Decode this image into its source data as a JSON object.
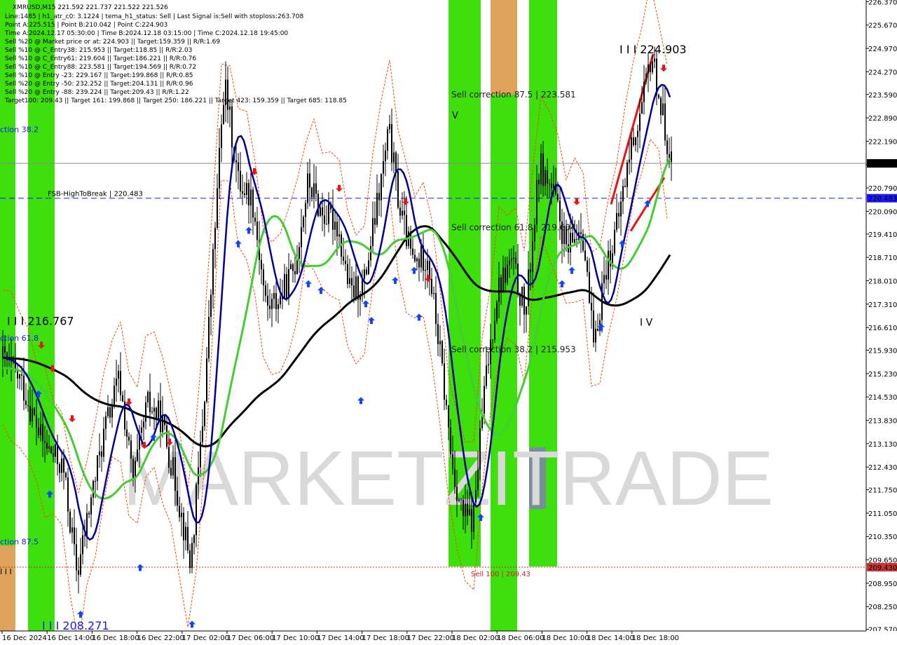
{
  "chart_data": {
    "type": "candlestick",
    "symbol_line": "XMRUSD,M15  221.592 221.737 221.522 221.526",
    "info_lines": [
      "Line:1485  | h1_atr_c0: 3.1224  | tema_h1_status: Sell  | Last Signal is:Sell with stoploss:263.708",
      "Point A:225.515  | Point B:210.042  | Point C:224.903",
      "Time A:2024.12.17 05:30:00  | Time B:2024.12.18 03:15:00  | Time C:2024.12.18 19:45:00",
      "Sell %20 @ Market price or at: 224.903  || Target:159.359  || R/R:1.69",
      "Sell %10 @ C_Entry38: 215.953  || Target:118.85  || R/R:2.03",
      "Sell %10 @ C_Entry61: 219.604  || Target:186.221  || R/R:0.76",
      "Sell %10 @ C_Entry88: 223.581  || Target:194.569  || R/R:0.72",
      "Sell %10 @ Entry -23: 229.167  || Target:199.868  || R/R:0.85",
      "Sell %20 @ Entry -50: 232.252  || Target:204.131  || R/R:0.96",
      "Sell %20 @ Entry -88: 239.224  || Target:209.43  || R/R:1.22",
      "Target100: 209.43  || Target 161: 199.868  || Target 250: 186.221  || Target 423: 159.359  || Target 685: 118.85"
    ],
    "y_ticks": [
      "226.370",
      "225.670",
      "224.970",
      "224.270",
      "223.590",
      "222.890",
      "222.190",
      "221.490",
      "220.790",
      "220.090",
      "219.410",
      "218.710",
      "218.010",
      "217.310",
      "216.610",
      "215.930",
      "215.230",
      "214.530",
      "213.830",
      "213.130",
      "212.430",
      "211.750",
      "211.050",
      "210.350",
      "209.650",
      "208.950",
      "208.250",
      "207.570"
    ],
    "y_range": [
      207.52,
      226.42
    ],
    "x_ticks": [
      "16 Dec 2024",
      "16 Dec 14:00",
      "16 Dec 18:00",
      "16 Dec 22:00",
      "17 Dec 02:00",
      "17 Dec 06:00",
      "17 Dec 10:00",
      "17 Dec 14:00",
      "17 Dec 18:00",
      "17 Dec 22:00",
      "18 Dec 02:00",
      "18 Dec 06:00",
      "18 Dec 10:00",
      "18 Dec 14:00",
      "18 Dec 18:00"
    ],
    "price_tags": [
      {
        "label": "221.526",
        "value": 221.526,
        "bg": "#000000",
        "color": "#ffffff"
      },
      {
        "label": "220.483",
        "value": 220.483,
        "bg": "#1a1aff",
        "color": "#ffffff"
      },
      {
        "label": "209.430",
        "value": 209.43,
        "bg": "#cc3333",
        "color": "#ffffff"
      }
    ],
    "levels": [
      {
        "label": "FSB-HighToBreak | 220.483",
        "value": 220.483,
        "color": "#1a1aff",
        "style": "dash"
      },
      {
        "label": "Sell 100 | 209.43",
        "value": 209.43,
        "color": "#cc2222",
        "style": "dot"
      },
      {
        "label": "",
        "value": 221.526,
        "color": "#888888",
        "style": "solid"
      }
    ],
    "annotations": [
      {
        "text": "Sell correction 87.5 | 223.581",
        "value": 223.581,
        "color": "#222222"
      },
      {
        "text": "Sell correction 61.8 | 219.604",
        "value": 219.604,
        "color": "#222222"
      },
      {
        "text": "Sell correction 38.2 | 215.953",
        "value": 215.953,
        "color": "#222222"
      },
      {
        "text": "I I I 224.903",
        "value": 224.903,
        "color": "#000000"
      },
      {
        "text": "I I I 216.767",
        "value": 216.767,
        "color": "#000000"
      },
      {
        "text": "I I I 208.271",
        "value": 208.271,
        "color": "#1a1aff"
      },
      {
        "text": "I V",
        "value": 216.767,
        "color": "#000000"
      },
      {
        "text": "V",
        "value": 222.95,
        "color": "#000000"
      },
      {
        "text": "I I I",
        "value": 209.3,
        "color": "#000000"
      },
      {
        "text": "ction 38.2",
        "value": 222.55,
        "color": "#1a1aff"
      },
      {
        "text": "ction 61.8",
        "value": 216.3,
        "color": "#1a1aff"
      },
      {
        "text": "ction 87.5",
        "value": 210.2,
        "color": "#1a1aff"
      }
    ],
    "watermark": "MARKETZITRADE",
    "colors": {
      "bull_zone": "#33dd00",
      "bear_zone": "#e8a060",
      "gray_zone": "#7a8aa0",
      "fast_ma": "#000099",
      "mid_ma": "#44cc33",
      "slow_ma": "#000000",
      "channel": "#ff4400",
      "candle": "#000000",
      "buy_arrow": "#1144ff",
      "sell_arrow": "#ee1111"
    }
  }
}
